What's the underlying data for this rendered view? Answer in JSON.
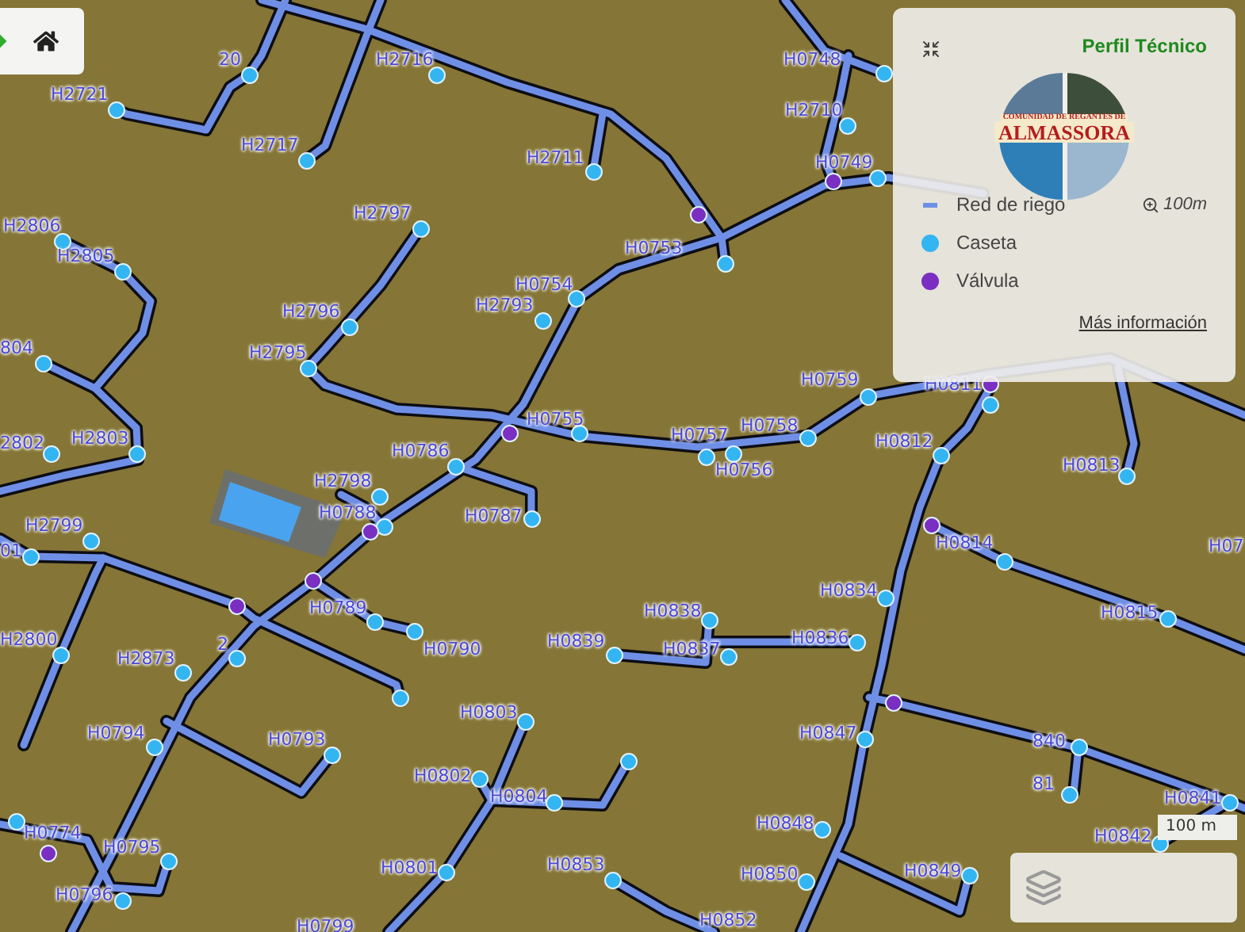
{
  "map": {
    "nodes": [
      {
        "label": "20",
        "kind": "caseta"
      },
      {
        "label": "H2716",
        "kind": "caseta"
      },
      {
        "label": "H2721",
        "kind": "caseta"
      },
      {
        "label": "H2717",
        "kind": "caseta"
      },
      {
        "label": "H2711",
        "kind": "caseta"
      },
      {
        "label": "H2806",
        "kind": "caseta"
      },
      {
        "label": "H2805",
        "kind": "caseta"
      },
      {
        "label": "H2797",
        "kind": "caseta"
      },
      {
        "label": "H0754",
        "kind": "caseta"
      },
      {
        "label": "H2793",
        "kind": "caseta"
      },
      {
        "label": "H2796",
        "kind": "caseta"
      },
      {
        "label": "H2795",
        "kind": "caseta"
      },
      {
        "label": "804",
        "kind": "caseta"
      },
      {
        "label": "2802",
        "kind": "caseta"
      },
      {
        "label": "H2803",
        "kind": "caseta"
      },
      {
        "label": "H0755",
        "kind": "caseta"
      },
      {
        "kind": "valvula"
      },
      {
        "label": "H0786",
        "kind": "caseta"
      },
      {
        "label": "H0748",
        "kind": "caseta"
      },
      {
        "label": "H2710",
        "kind": "caseta"
      },
      {
        "label": "H0749",
        "kind": "caseta"
      },
      {
        "kind": "valvula"
      },
      {
        "kind": "valvula"
      },
      {
        "label": "H0753",
        "kind": "caseta"
      },
      {
        "label": "H0759",
        "kind": "caseta"
      },
      {
        "label": "H0811",
        "kind": "caseta"
      },
      {
        "kind": "valvula"
      },
      {
        "label": "H0758",
        "kind": "caseta"
      },
      {
        "label": "H0757",
        "kind": "caseta"
      },
      {
        "label": "H0756",
        "kind": "caseta"
      },
      {
        "label": "H0812",
        "kind": "caseta"
      },
      {
        "label": "H0813",
        "kind": "caseta"
      },
      {
        "label": "H2798",
        "kind": "caseta"
      },
      {
        "label": "H0788",
        "kind": "caseta"
      },
      {
        "kind": "valvula"
      },
      {
        "label": "H0787",
        "kind": "caseta"
      },
      {
        "label": "H2799",
        "kind": "caseta"
      },
      {
        "label": "01",
        "kind": "caseta"
      },
      {
        "kind": "valvula"
      },
      {
        "kind": "valvula"
      },
      {
        "label": "H0789",
        "kind": "caseta"
      },
      {
        "label": "H0790",
        "kind": "caseta"
      },
      {
        "label": "H2800",
        "kind": "caseta"
      },
      {
        "label": "2",
        "kind": "caseta"
      },
      {
        "label": "H2873",
        "kind": "caseta"
      },
      {
        "kind": "caseta"
      },
      {
        "label": "H0839",
        "kind": "caseta"
      },
      {
        "label": "H0803",
        "kind": "caseta"
      },
      {
        "label": "H0794",
        "kind": "caseta"
      },
      {
        "label": "H0793",
        "kind": "caseta"
      },
      {
        "label": "H0802",
        "kind": "caseta"
      },
      {
        "label": "H0804",
        "kind": "caseta"
      },
      {
        "kind": "caseta"
      },
      {
        "label": "H0774",
        "kind": "caseta"
      },
      {
        "kind": "valvula"
      },
      {
        "label": "H0795",
        "kind": "caseta"
      },
      {
        "label": "H0801",
        "kind": "caseta"
      },
      {
        "label": "H0853",
        "kind": "caseta"
      },
      {
        "label": "H0796",
        "kind": "caseta"
      },
      {
        "label": "H0799",
        "kind": "caseta"
      },
      {
        "label": "H0814",
        "kind": "caseta"
      },
      {
        "kind": "valvula"
      },
      {
        "label": "H0834",
        "kind": "caseta"
      },
      {
        "label": "H0815",
        "kind": "caseta"
      },
      {
        "label": "H07",
        "kind": "caseta"
      },
      {
        "label": "H0838",
        "kind": "caseta"
      },
      {
        "label": "H0836",
        "kind": "caseta"
      },
      {
        "label": "H0837",
        "kind": "caseta"
      },
      {
        "kind": "valvula"
      },
      {
        "label": "H0847",
        "kind": "caseta"
      },
      {
        "label": "840",
        "kind": "caseta"
      },
      {
        "label": "81",
        "kind": "caseta"
      },
      {
        "label": "H0841",
        "kind": "caseta"
      },
      {
        "label": "H0842",
        "kind": "caseta"
      },
      {
        "label": "H0848",
        "kind": "caseta"
      },
      {
        "label": "H0850",
        "kind": "caseta"
      },
      {
        "label": "H0849",
        "kind": "caseta"
      },
      {
        "label": "H0852",
        "kind": "caseta"
      }
    ],
    "scale": "100 m"
  },
  "panel": {
    "title": "Perfil Técnico",
    "logo_lines": [
      "COMUNIDAD DE REGANTES DE",
      "ALMASSORA"
    ],
    "legend": [
      {
        "label": "Red de riego",
        "kind": "line"
      },
      {
        "label": "Caseta",
        "kind": "caseta"
      },
      {
        "label": "Válvula",
        "kind": "valvula"
      }
    ],
    "zoom_reading": "100m",
    "link": "Más información"
  }
}
